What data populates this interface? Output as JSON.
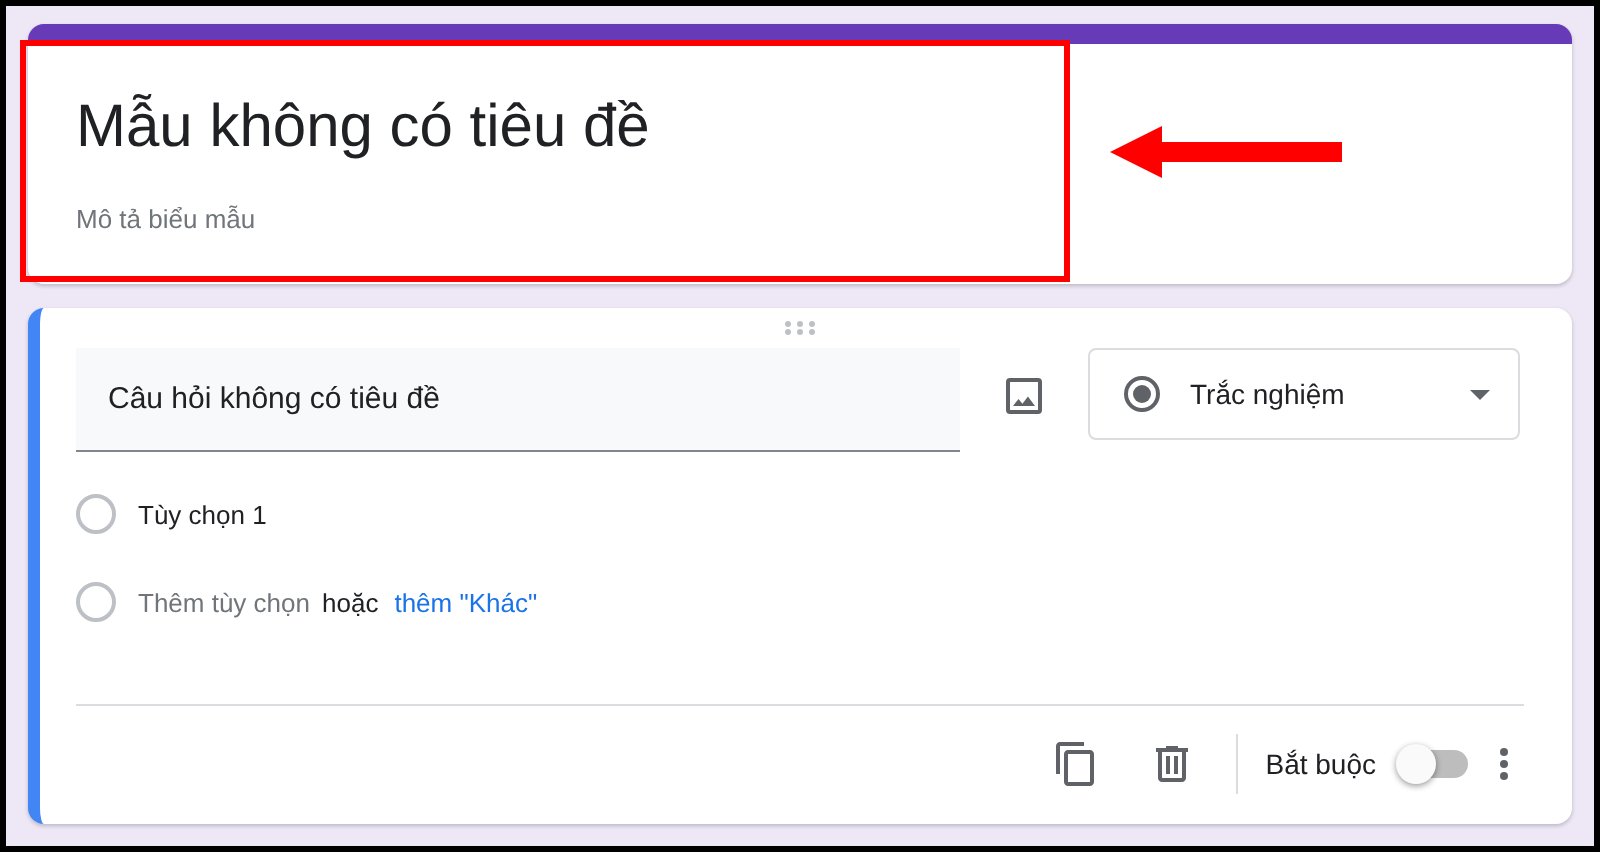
{
  "form": {
    "title": "Mẫu không có tiêu đề",
    "description": {
      "placeholder": "Mô tả biểu mẫu"
    }
  },
  "question": {
    "title": "Câu hỏi không có tiêu đề",
    "type": "Trắc nghiệm",
    "options": [
      {
        "label": "Tùy chọn 1",
        "checked": false
      }
    ],
    "add_option": {
      "checked": false,
      "placeholder": "Thêm tùy chọn",
      "or": "hoặc",
      "other_link": "thêm \"Khác\""
    },
    "required": {
      "label": "Bắt buộc",
      "on": false
    }
  }
}
